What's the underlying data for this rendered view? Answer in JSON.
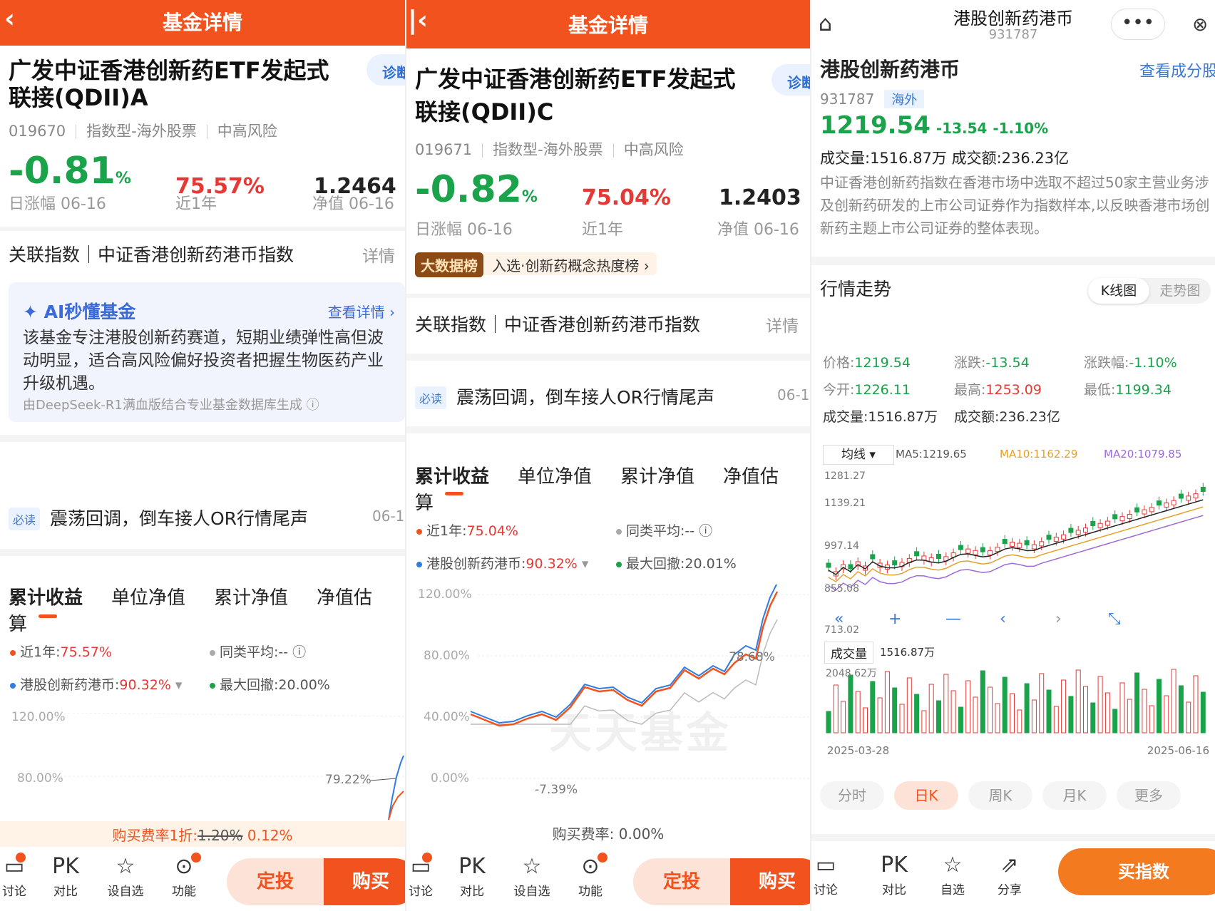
{
  "left": {
    "header_title": "基金详情",
    "fund_name_1": "广发中证香港创新药ETF发起式",
    "fund_name_2": "联接(QDII)A",
    "diag_label": "诊断",
    "code": "019670",
    "type": "指数型-海外股票",
    "risk": "中高风险",
    "day_change": "-0.81",
    "day_change_unit": "%",
    "day_change_label": "日涨幅 06-16",
    "year_return": "75.57%",
    "year_return_label": "近1年",
    "nav": "1.2464",
    "nav_label": "净值 06-16",
    "related_index": "关联指数｜中证香港创新药港币指数",
    "detail_link": "详情",
    "ai_title": "AI秒懂基金",
    "ai_more": "查看详情 ›",
    "ai_text": "该基金专注港股创新药赛道，短期业绩弹性高但波动明显，适合高风险偏好投资者把握生物医药产业升级机遇。",
    "ai_footer": "由DeepSeek-R1满血版结合专业基金数据库生成",
    "read_badge": "必读",
    "news_title": "震荡回调，倒车接人OR行情尾声",
    "news_date": "06-1",
    "tabs": [
      "累计收益",
      "单位净值",
      "累计净值",
      "净值估算"
    ],
    "legend_1_label": "近1年:",
    "legend_1_value": "75.57%",
    "legend_2": "同类平均:--",
    "legend_3_label": "港股创新药港币:",
    "legend_3_value": "90.32%",
    "legend_4": "最大回撤:20.00%",
    "axis_1": "120.00%",
    "axis_2": "80.00%",
    "point_label": "79.22%",
    "fee_prefix": "购买费率1折:",
    "fee_old": "1.20%",
    "fee_new": "0.12%",
    "nav_items": [
      "讨论",
      "对比",
      "设自选",
      "功能"
    ],
    "btn_dt": "定投",
    "btn_buy": "购买"
  },
  "mid": {
    "header_title": "基金详情",
    "fund_name_1": "广发中证香港创新药ETF发起式",
    "fund_name_2": "联接(QDII)C",
    "diag_label": "诊断",
    "code": "019671",
    "type": "指数型-海外股票",
    "risk": "中高风险",
    "day_change": "-0.82",
    "day_change_unit": "%",
    "day_change_label": "日涨幅 06-16",
    "year_return": "75.04%",
    "year_return_label": "近1年",
    "nav": "1.2403",
    "nav_label": "净值 06-16",
    "bigdata_tag": "大数据榜",
    "bigdata_text": "入选·创新药概念热度榜 ›",
    "related_index": "关联指数｜中证香港创新药港币指数",
    "detail_link": "详情",
    "read_badge": "必读",
    "news_title": "震荡回调，倒车接人OR行情尾声",
    "news_date": "06-1",
    "tabs": [
      "累计收益",
      "单位净值",
      "累计净值",
      "净值估算"
    ],
    "legend_1_label": "近1年:",
    "legend_1_value": "75.04%",
    "legend_2": "同类平均:--",
    "legend_3_label": "港股创新药港币:",
    "legend_3_value": "90.32%",
    "legend_4": "最大回撤:20.01%",
    "axis": [
      "120.00%",
      "80.00%",
      "40.00%",
      "0.00%"
    ],
    "high_label": "78.68%",
    "low_label": "-7.39%",
    "watermark": "天天基金",
    "fee": "购买费率: 0.00%",
    "nav_items": [
      "讨论",
      "对比",
      "设自选",
      "功能"
    ],
    "btn_dt": "定投",
    "btn_buy": "购买"
  },
  "right": {
    "header_title": "港股创新药港币",
    "header_code": "931787",
    "index_name": "港股创新药港币",
    "view_components": "查看成分股",
    "code": "931787",
    "region_tag": "海外",
    "price": "1219.54",
    "change": "-13.54",
    "change_pct": "-1.10%",
    "volume_line": "成交量:1516.87万   成交额:236.23亿",
    "description": "中证香港创新药指数在香港市场中选取不超过50家主营业务涉及创新药研发的上市公司证券作为指数样本,以反映香港市场创新药主题上市公司证券的整体表现。",
    "section_title": "行情走势",
    "ktab_k": "K线图",
    "ktab_trend": "走势图",
    "q_price_label": "价格:",
    "q_price": "1219.54",
    "q_chg_label": "涨跌:",
    "q_chg": "-13.54",
    "q_pct_label": "涨跌幅:",
    "q_pct": "-1.10%",
    "q_open_label": "今开:",
    "q_open": "1226.11",
    "q_high_label": "最高:",
    "q_high": "1253.09",
    "q_low_label": "最低:",
    "q_low": "1199.34",
    "q_vol": "成交量:1516.87万",
    "q_amt": "成交额:236.23亿",
    "ma_select": "均线 ▾",
    "ma5": "MA5:1219.65",
    "ma10": "MA10:1162.29",
    "ma20": "MA20:1079.85",
    "k_axis": [
      "1281.27",
      "1139.21",
      "997.14",
      "855.08",
      "713.02"
    ],
    "vol_label": "成交量",
    "vol_value": "1516.87万",
    "vol_axis": "2048.62万",
    "date_start": "2025-03-28",
    "date_end": "2025-06-16",
    "periods": [
      "分时",
      "日K",
      "周K",
      "月K",
      "更多"
    ],
    "nav_items": [
      "讨论",
      "对比",
      "自选",
      "分享"
    ],
    "btn_buy_index": "买指数",
    "colors": {
      "up": "#e53935",
      "down": "#1aa34a",
      "accent": "#f2531e"
    }
  }
}
